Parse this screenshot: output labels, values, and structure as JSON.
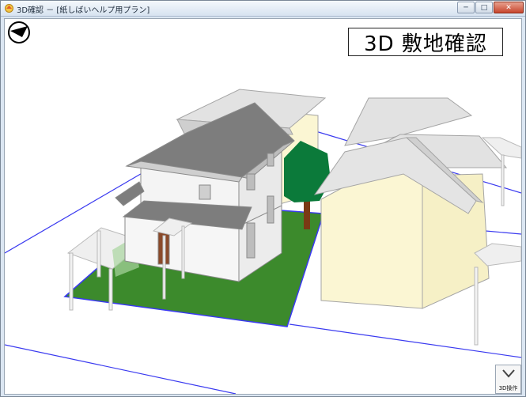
{
  "window": {
    "title": "3D確認 － [紙しばいヘルプ用プラン]",
    "minimize": "─",
    "maximize": "□",
    "close": "✕"
  },
  "viewport": {
    "heading": "3D 敷地確認",
    "compass_icon": "north-arrow-icon",
    "operation_button_label": "3D操作",
    "operation_icon": "chevron-down-icon"
  },
  "colors": {
    "lawn": "#3c8a2c",
    "boundary": "#3a3af0",
    "roof": "#7d7d7d",
    "wall": "#f4f4f4",
    "neighbor_wall": "#fbf6d3",
    "neighbor_roof": "#e0e0e0",
    "tree": "#0b7a3a",
    "trunk": "#7a3a14"
  }
}
